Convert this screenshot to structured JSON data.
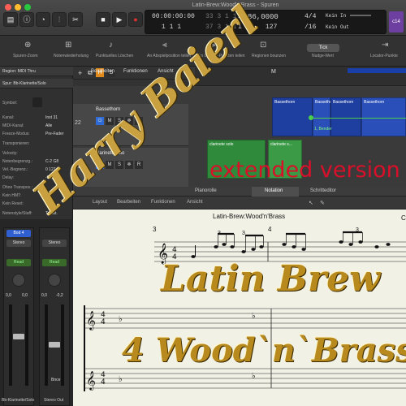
{
  "window": {
    "title": "Latin-Brew:Wood'n'Brass - Spuren"
  },
  "lcd": {
    "time": "00:00:00:00",
    "time_sub": "1 1 1",
    "bars": "33 3 1 1",
    "bars_sub": "37 3 1 1",
    "pos_a": "1",
    "pos_b": "1",
    "tempo": "86,0000",
    "tempo_sub": "127",
    "sig": "4/4",
    "div": "/16",
    "in_label": "Kein In",
    "out_label": "Kein Out",
    "badge": "c14"
  },
  "toolbar2": {
    "items": [
      "Spuren-Zoom",
      "Notenwiederholung",
      "Punktuelles Löschen",
      "An Abspielposition teilen",
      "An Locator-Punkten teilen",
      "Regionen bounzen",
      "Nudge-Wert",
      "Locator-Punkte"
    ],
    "nudge_value": "Tick"
  },
  "arrange_menu": [
    "Bearbeiten",
    "Funktionen",
    "Ansicht"
  ],
  "inspector": {
    "region": "Region: MIDI Thru",
    "track": "Spur: Bb-Klarinette/Solo",
    "rows": [
      {
        "label": "Symbol:",
        "value": ""
      },
      {
        "label": "Kanal:",
        "value": "Inst 31"
      },
      {
        "label": "MIDI-Kanal:",
        "value": "Alle"
      },
      {
        "label": "Freeze-Modus:",
        "value": "Pre-Fader"
      },
      {
        "label": "Transponieren:",
        "value": ""
      },
      {
        "label": "Velocity:",
        "value": ""
      },
      {
        "label": "Notenbegrenzg.:",
        "value": "C-2  G8"
      },
      {
        "label": "Vel.-Begrenz.:",
        "value": "0  127"
      },
      {
        "label": "Delay:",
        "value": "-90,9 ms"
      },
      {
        "label": "Ohne Transpos.:",
        "value": ""
      },
      {
        "label": "Kein HMT:",
        "value": ""
      },
      {
        "label": "Kein Reset:",
        "value": ""
      },
      {
        "label": "Notenstyle/Staff:",
        "value": "Tastat."
      }
    ]
  },
  "tracks": [
    {
      "num": "22",
      "name": "Bassethorn"
    },
    {
      "num": "25",
      "name": "clarinete solo"
    }
  ],
  "regions": [
    {
      "label": "Bassethorn"
    },
    {
      "label": "Bassethorn"
    },
    {
      "label": "Bassethorn"
    },
    {
      "label": "Bassethorn"
    },
    {
      "label": "clarinete solo"
    },
    {
      "label": "clarinete s..."
    },
    {
      "label": "1, Bender"
    }
  ],
  "ruler": {
    "mark": "M"
  },
  "editor_tabs": [
    "Pianorolle",
    "Notation",
    "Schritteditor"
  ],
  "editor_menu": [
    "Layout",
    "Bearbeiten",
    "Funktionen",
    "Ansicht"
  ],
  "score": {
    "title": "Latin-Brew:Wood'n'Brass",
    "bar_a": "3",
    "bar_b": "4",
    "triplet": "3",
    "corner": "Co"
  },
  "mixer": {
    "channels": [
      {
        "name": "Bb-Klarinette/Solo",
        "insert": "Bod 4",
        "out": "Stereo",
        "mode": "Read",
        "vol": "0,0",
        "pan": "0,0"
      },
      {
        "name": "Stereo Out",
        "insert": "",
        "out": "Stereo",
        "mode": "Read",
        "vol": "0,0",
        "pan": "-0,2",
        "label": "Bnce"
      }
    ]
  },
  "watermark": {
    "artist": "Harry Baierl",
    "edition": "extended version",
    "line1": "Latin Brew",
    "line2": "4 Wood`n`Brass"
  },
  "colors": {
    "accent_blue": "#1a3fa8",
    "region_green": "#3b8a3b",
    "edition_red": "#d8102a",
    "gold": "#b8891c"
  }
}
